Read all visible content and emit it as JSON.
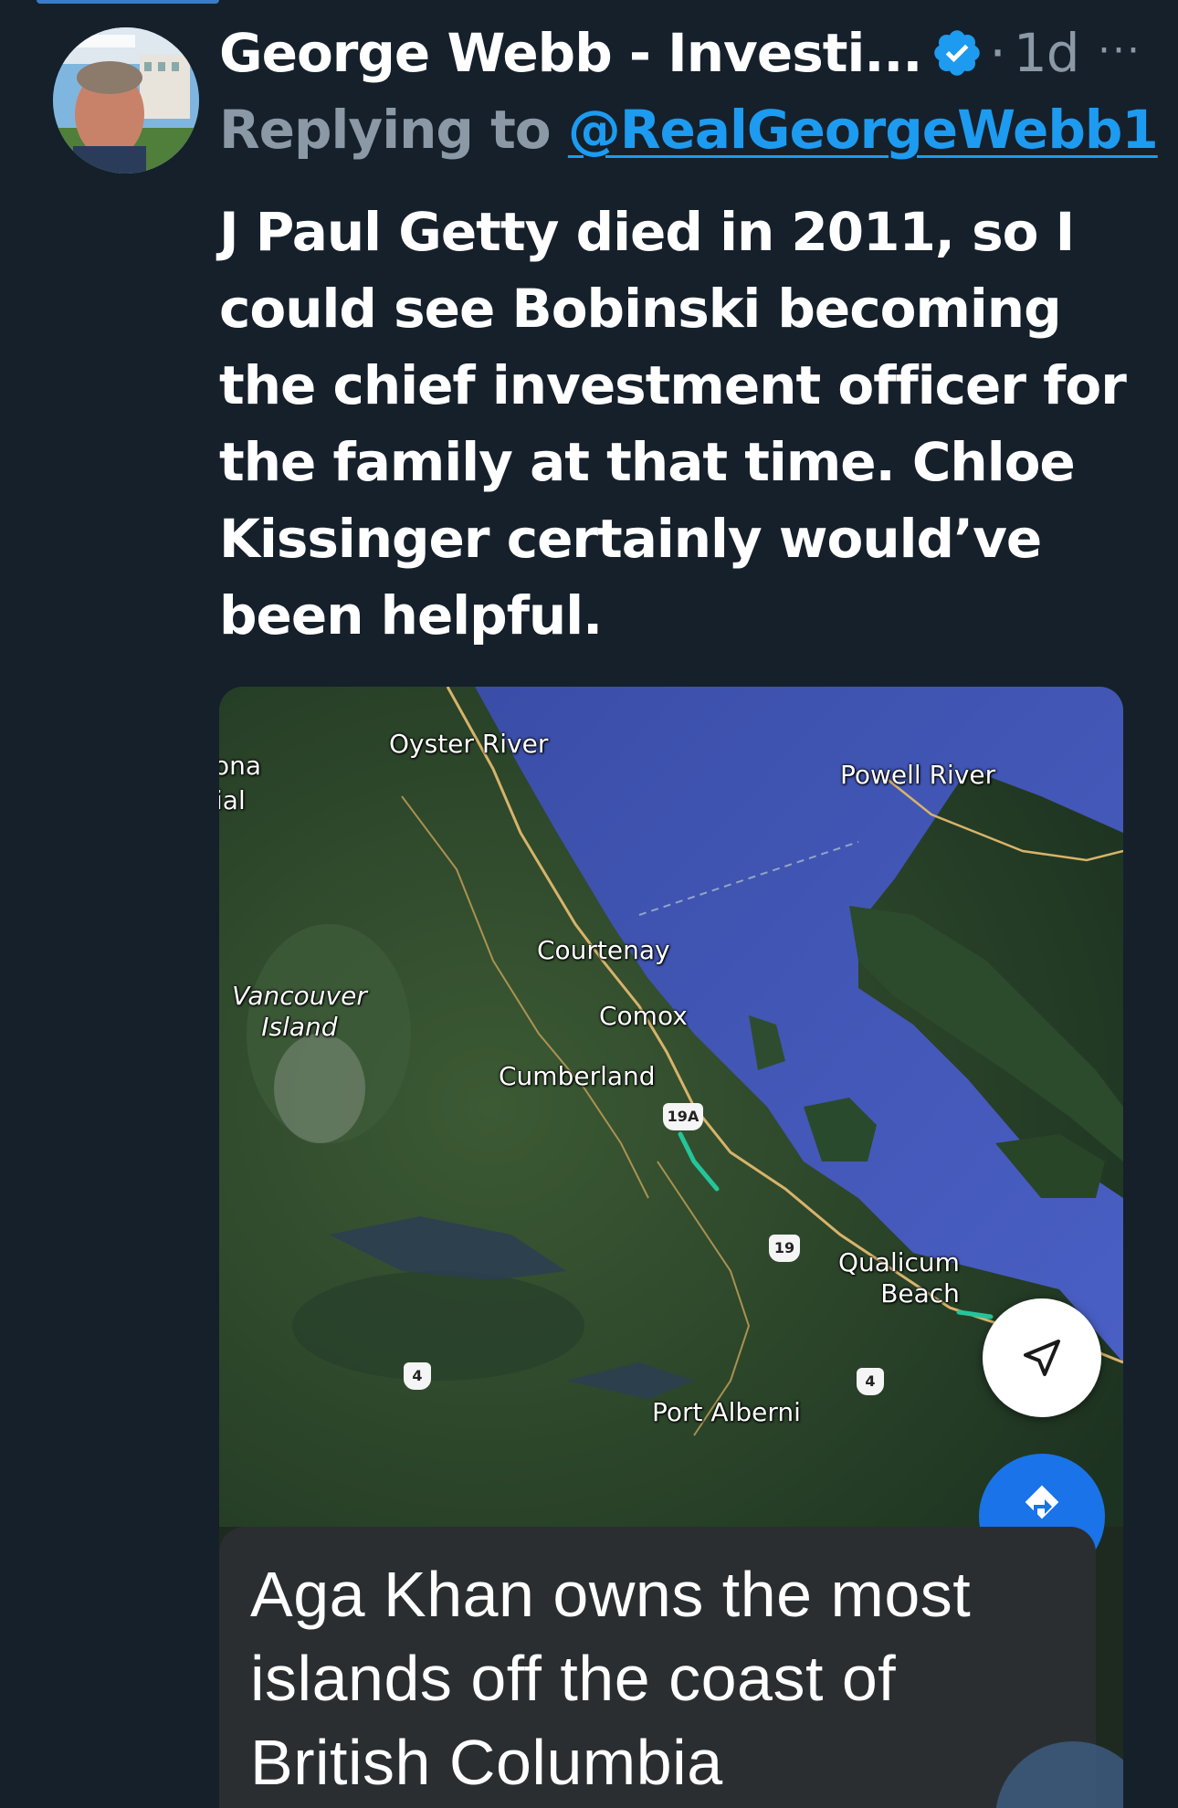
{
  "tweet": {
    "author_name": "George Webb - Investi...",
    "verified": true,
    "separator": "·",
    "timestamp": "1d",
    "more_label": "···",
    "replying_prefix": "Replying to ",
    "replying_handle": "@RealGeorgeWebb1",
    "text": "J Paul Getty died in 2011, so I could see Bobinski becoming the chief investment officer for the family at that time. Chloe Kissinger certainly would’ve been helpful."
  },
  "colors": {
    "background": "#15202b",
    "muted_text": "#8b98a5",
    "link": "#1d9bf0",
    "verified_badge": "#1d9bf0"
  },
  "map": {
    "labels": {
      "oyster_river": "Oyster River",
      "powell_river": "Powell River",
      "courtenay": "Courtenay",
      "comox": "Comox",
      "cumberland": "Cumberland",
      "vancouver_island": "Vancouver\nIsland",
      "qualicum_beach": "Qualicum\nBeach",
      "port_alberni": "Port Alberni",
      "edge_na": "ona",
      "edge_ial": "ial"
    },
    "shields": {
      "hwy_19a": "19A",
      "hwy_19": "19",
      "hwy_4_west": "4",
      "hwy_4_east": "4"
    },
    "icons": {
      "navigate": "navigation-arrow-icon",
      "directions": "directions-icon"
    }
  },
  "caption": {
    "text": "Aga Khan owns the most islands off the coast of British Columbia"
  }
}
